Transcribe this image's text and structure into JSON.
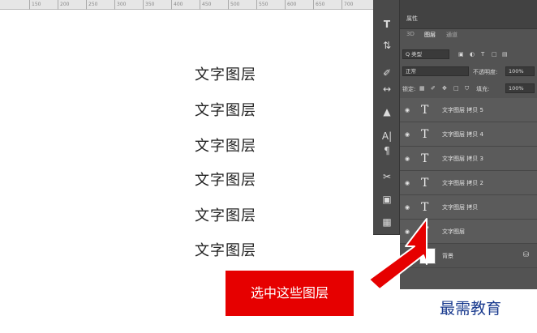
{
  "ruler": {
    "ticks": [
      "150",
      "200",
      "250",
      "300",
      "350",
      "400",
      "450",
      "500",
      "550",
      "600",
      "650",
      "700"
    ]
  },
  "canvas": {
    "layers_text": [
      "文字图层",
      "文字图层",
      "文字图层",
      "文字图层",
      "文字图层",
      "文字图层"
    ]
  },
  "toolbar": {
    "icons": [
      "type-tool",
      "adjust-tool",
      "brush-tool",
      "gradient-tool",
      "stamp-tool",
      "text-tool",
      "paragraph-tool",
      "scissors-tool",
      "3d-tool",
      "history-tool"
    ]
  },
  "panel": {
    "top_tab": "属性",
    "tabs": [
      "3D",
      "图层",
      "通道"
    ],
    "filter": {
      "label": "Q 类型",
      "icons": [
        "image",
        "adjust",
        "text",
        "shape",
        "smart"
      ]
    },
    "blend_mode": "正常",
    "opacity_label": "不透明度:",
    "opacity_value": "100%",
    "lock_label": "锁定:",
    "fill_label": "填充:",
    "fill_value": "100%",
    "layers": [
      {
        "name": "文字图层 拷贝 5",
        "kind": "text"
      },
      {
        "name": "文字图层 拷贝 4",
        "kind": "text"
      },
      {
        "name": "文字图层 拷贝 3",
        "kind": "text"
      },
      {
        "name": "文字图层 拷贝 2",
        "kind": "text"
      },
      {
        "name": "文字图层 拷贝",
        "kind": "text"
      },
      {
        "name": "文字图层",
        "kind": "text"
      },
      {
        "name": "背景",
        "kind": "background"
      }
    ]
  },
  "callout": {
    "label": "选中这些图层"
  },
  "watermark": {
    "text": "最需教育"
  },
  "colors": {
    "callout_red": "#e60000",
    "panel_gray": "#535353",
    "watermark_blue": "#1a3b8f"
  }
}
